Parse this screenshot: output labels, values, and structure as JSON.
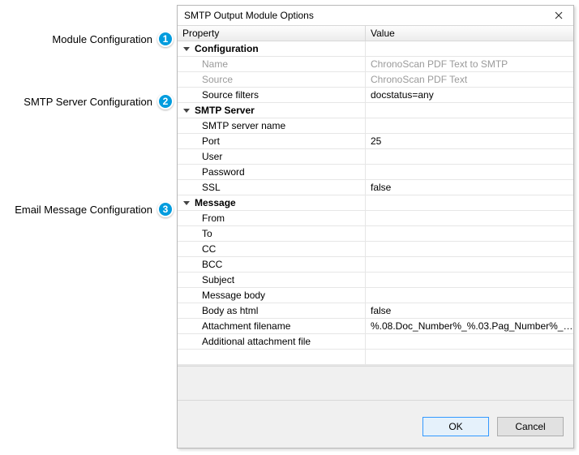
{
  "annotations": {
    "a1": {
      "num": "1",
      "text": "Module Configuration"
    },
    "a2": {
      "num": "2",
      "text": "SMTP Server Configuration"
    },
    "a3": {
      "num": "3",
      "text": "Email Message Configuration"
    }
  },
  "dialog": {
    "title": "SMTP Output Module Options",
    "columns": {
      "property": "Property",
      "value": "Value"
    },
    "groups": {
      "configuration": {
        "label": "Configuration",
        "rows": {
          "name": {
            "label": "Name",
            "value": "ChronoScan PDF Text to SMTP"
          },
          "source": {
            "label": "Source",
            "value": "ChronoScan PDF Text"
          },
          "filters": {
            "label": "Source filters",
            "value": "docstatus=any"
          }
        }
      },
      "smtp": {
        "label": "SMTP Server",
        "rows": {
          "server": {
            "label": "SMTP server name",
            "value": ""
          },
          "port": {
            "label": "Port",
            "value": "25"
          },
          "user": {
            "label": "User",
            "value": ""
          },
          "password": {
            "label": "Password",
            "value": ""
          },
          "ssl": {
            "label": "SSL",
            "value": "false"
          }
        }
      },
      "message": {
        "label": "Message",
        "rows": {
          "from": {
            "label": "From",
            "value": ""
          },
          "to": {
            "label": "To",
            "value": ""
          },
          "cc": {
            "label": "CC",
            "value": ""
          },
          "bcc": {
            "label": "BCC",
            "value": ""
          },
          "subject": {
            "label": "Subject",
            "value": ""
          },
          "body": {
            "label": "Message body",
            "value": ""
          },
          "bodyhtml": {
            "label": "Body as html",
            "value": "false"
          },
          "attachname": {
            "label": "Attachment filename",
            "value": "%.08.Doc_Number%_%.03.Pag_Number%_of_..."
          },
          "extrafile": {
            "label": "Additional attachment file",
            "value": ""
          }
        }
      }
    },
    "buttons": {
      "ok": "OK",
      "cancel": "Cancel"
    }
  }
}
